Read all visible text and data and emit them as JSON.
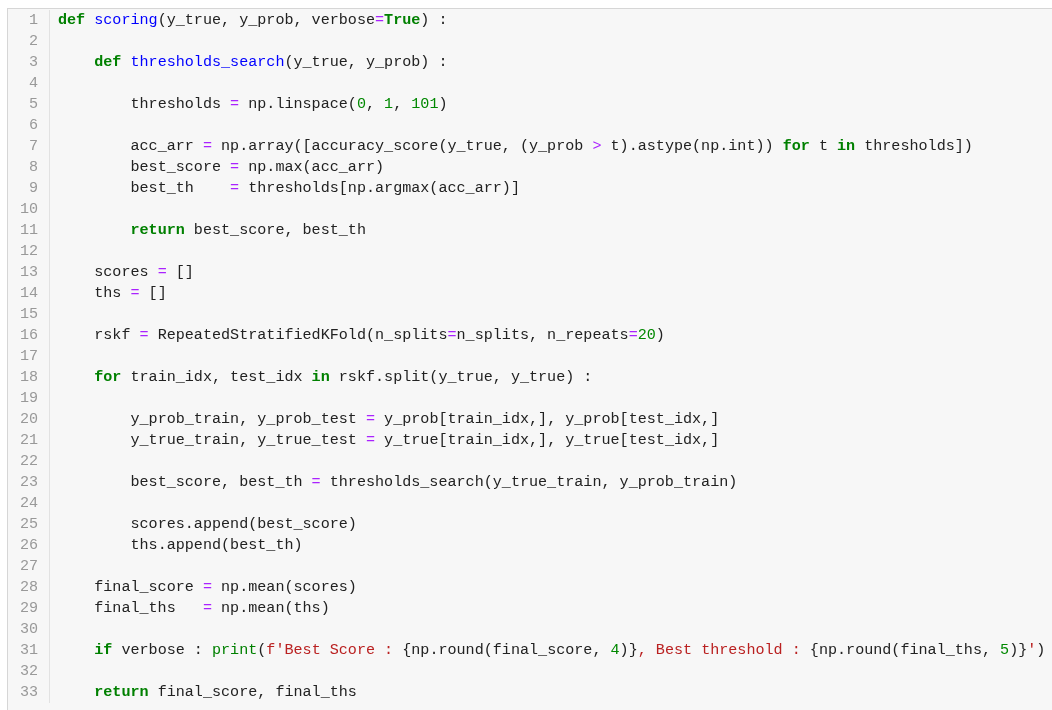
{
  "code_editor": {
    "lines": [
      {
        "number": "1",
        "tokens": [
          {
            "kind": "keyword",
            "text": "def "
          },
          {
            "kind": "function",
            "text": "scoring"
          },
          {
            "kind": "plain",
            "text": "(y_true, y_prob, verbose"
          },
          {
            "kind": "operator",
            "text": "="
          },
          {
            "kind": "keyword",
            "text": "True"
          },
          {
            "kind": "plain",
            "text": ") :"
          }
        ],
        "children": [
          {
            "number": "2"
          },
          {
            "number": "3",
            "tokens": [
              {
                "kind": "keyword",
                "text": "def "
              },
              {
                "kind": "function",
                "text": "thresholds_search"
              },
              {
                "kind": "plain",
                "text": "(y_true, y_prob) :"
              }
            ],
            "children": [
              {
                "number": "4"
              },
              {
                "number": "5",
                "tokens": [
                  {
                    "kind": "plain",
                    "text": "thresholds "
                  },
                  {
                    "kind": "operator",
                    "text": "="
                  },
                  {
                    "kind": "plain",
                    "text": " np.linspace("
                  },
                  {
                    "kind": "number",
                    "text": "0"
                  },
                  {
                    "kind": "plain",
                    "text": ", "
                  },
                  {
                    "kind": "number",
                    "text": "1"
                  },
                  {
                    "kind": "plain",
                    "text": ", "
                  },
                  {
                    "kind": "number",
                    "text": "101"
                  },
                  {
                    "kind": "plain",
                    "text": ")"
                  }
                ]
              },
              {
                "number": "6"
              },
              {
                "number": "7",
                "tokens": [
                  {
                    "kind": "plain",
                    "text": "acc_arr "
                  },
                  {
                    "kind": "operator",
                    "text": "="
                  },
                  {
                    "kind": "plain",
                    "text": " np.array([accuracy_score(y_true, (y_prob "
                  },
                  {
                    "kind": "operator",
                    "text": ">"
                  },
                  {
                    "kind": "plain",
                    "text": " t).astype(np.int)) "
                  },
                  {
                    "kind": "keyword",
                    "text": "for"
                  },
                  {
                    "kind": "plain",
                    "text": " t "
                  },
                  {
                    "kind": "keyword",
                    "text": "in"
                  },
                  {
                    "kind": "plain",
                    "text": " thresholds])"
                  }
                ]
              },
              {
                "number": "8",
                "tokens": [
                  {
                    "kind": "plain",
                    "text": "best_score "
                  },
                  {
                    "kind": "operator",
                    "text": "="
                  },
                  {
                    "kind": "plain",
                    "text": " np.max(acc_arr)"
                  }
                ]
              },
              {
                "number": "9",
                "tokens": [
                  {
                    "kind": "plain",
                    "text": "best_th    "
                  },
                  {
                    "kind": "operator",
                    "text": "="
                  },
                  {
                    "kind": "plain",
                    "text": " thresholds[np.argmax(acc_arr)]"
                  }
                ]
              },
              {
                "number": "10"
              },
              {
                "number": "11",
                "tokens": [
                  {
                    "kind": "keyword",
                    "text": "return "
                  },
                  {
                    "kind": "plain",
                    "text": "best_score, best_th"
                  }
                ]
              }
            ]
          },
          {
            "number": "12"
          },
          {
            "number": "13",
            "tokens": [
              {
                "kind": "plain",
                "text": "scores "
              },
              {
                "kind": "operator",
                "text": "="
              },
              {
                "kind": "plain",
                "text": " []"
              }
            ]
          },
          {
            "number": "14",
            "tokens": [
              {
                "kind": "plain",
                "text": "ths "
              },
              {
                "kind": "operator",
                "text": "="
              },
              {
                "kind": "plain",
                "text": " []"
              }
            ]
          },
          {
            "number": "15"
          },
          {
            "number": "16",
            "tokens": [
              {
                "kind": "plain",
                "text": "rskf "
              },
              {
                "kind": "operator",
                "text": "="
              },
              {
                "kind": "plain",
                "text": " RepeatedStratifiedKFold(n_splits"
              },
              {
                "kind": "operator",
                "text": "="
              },
              {
                "kind": "plain",
                "text": "n_splits, n_repeats"
              },
              {
                "kind": "operator",
                "text": "="
              },
              {
                "kind": "number",
                "text": "20"
              },
              {
                "kind": "plain",
                "text": ")"
              }
            ]
          },
          {
            "number": "17"
          },
          {
            "number": "18",
            "tokens": [
              {
                "kind": "keyword",
                "text": "for "
              },
              {
                "kind": "plain",
                "text": "train_idx, test_idx "
              },
              {
                "kind": "keyword",
                "text": "in "
              },
              {
                "kind": "plain",
                "text": "rskf.split(y_true, y_true) :"
              }
            ],
            "children": [
              {
                "number": "19"
              },
              {
                "number": "20",
                "tokens": [
                  {
                    "kind": "plain",
                    "text": "y_prob_train, y_prob_test "
                  },
                  {
                    "kind": "operator",
                    "text": "="
                  },
                  {
                    "kind": "plain",
                    "text": " y_prob[train_idx,], y_prob[test_idx,]"
                  }
                ]
              },
              {
                "number": "21",
                "tokens": [
                  {
                    "kind": "plain",
                    "text": "y_true_train, y_true_test "
                  },
                  {
                    "kind": "operator",
                    "text": "="
                  },
                  {
                    "kind": "plain",
                    "text": " y_true[train_idx,], y_true[test_idx,]"
                  }
                ]
              },
              {
                "number": "22"
              },
              {
                "number": "23",
                "tokens": [
                  {
                    "kind": "plain",
                    "text": "best_score, best_th "
                  },
                  {
                    "kind": "operator",
                    "text": "="
                  },
                  {
                    "kind": "plain",
                    "text": " thresholds_search(y_true_train, y_prob_train)"
                  }
                ]
              },
              {
                "number": "24"
              },
              {
                "number": "25",
                "tokens": [
                  {
                    "kind": "plain",
                    "text": "scores.append(best_score)"
                  }
                ]
              },
              {
                "number": "26",
                "tokens": [
                  {
                    "kind": "plain",
                    "text": "ths.append(best_th)"
                  }
                ]
              }
            ]
          },
          {
            "number": "27"
          },
          {
            "number": "28",
            "tokens": [
              {
                "kind": "plain",
                "text": "final_score "
              },
              {
                "kind": "operator",
                "text": "="
              },
              {
                "kind": "plain",
                "text": " np.mean(scores)"
              }
            ]
          },
          {
            "number": "29",
            "tokens": [
              {
                "kind": "plain",
                "text": "final_ths   "
              },
              {
                "kind": "operator",
                "text": "="
              },
              {
                "kind": "plain",
                "text": " np.mean(ths)"
              }
            ]
          },
          {
            "number": "30"
          },
          {
            "number": "31",
            "tokens": [
              {
                "kind": "keyword",
                "text": "if "
              },
              {
                "kind": "plain",
                "text": "verbose : "
              },
              {
                "kind": "builtin",
                "text": "print"
              },
              {
                "kind": "plain",
                "text": "("
              },
              {
                "kind": "string",
                "text": "f'Best Score : "
              },
              {
                "kind": "plain",
                "text": "{np.round(final_score, "
              },
              {
                "kind": "number",
                "text": "4"
              },
              {
                "kind": "plain",
                "text": ")}"
              },
              {
                "kind": "string",
                "text": ", Best threshold : "
              },
              {
                "kind": "plain",
                "text": "{np.round(final_ths, "
              },
              {
                "kind": "number",
                "text": "5"
              },
              {
                "kind": "plain",
                "text": ")}"
              },
              {
                "kind": "string",
                "text": "'"
              },
              {
                "kind": "plain",
                "text": ")"
              }
            ]
          },
          {
            "number": "32"
          },
          {
            "number": "33",
            "tokens": [
              {
                "kind": "keyword",
                "text": "return "
              },
              {
                "kind": "plain",
                "text": "final_score, final_ths"
              }
            ]
          }
        ]
      }
    ]
  }
}
